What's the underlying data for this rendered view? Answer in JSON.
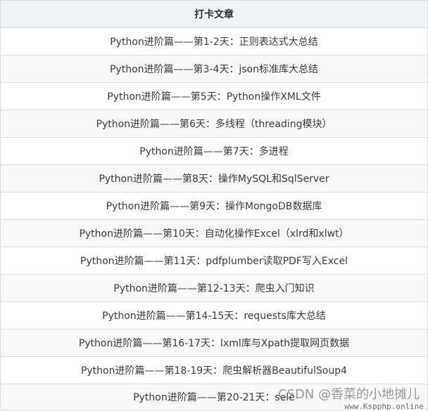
{
  "table": {
    "header": "打卡文章",
    "rows": [
      "Python进阶篇——第1-2天：正则表达式大总结",
      "Python进阶篇——第3-4天：json标准库大总结",
      "Python进阶篇——第5天：Python操作XML文件",
      "Python进阶篇——第6天：多线程（threading模块）",
      "Python进阶篇——第7天：多进程",
      "Python进阶篇——第8天：操作MySQL和SqlServer",
      "Python进阶篇——第9天：操作MongoDB数据库",
      "Python进阶篇——第10天：自动化操作Excel（xlrd和xlwt）",
      "Python进阶篇——第11天：pdfplumber读取PDF写入Excel",
      "Python进阶篇——第12-13天：爬虫入门知识",
      "Python进阶篇——第14-15天：requests库大总结",
      "Python进阶篇——第16-17天：lxml库与Xpath提取网页数据",
      "Python进阶篇——第18-19天：爬虫解析器BeautifulSoup4",
      "Python进阶篇——第20-21天：sele"
    ]
  },
  "watermark": {
    "text": "CSDN @香菜的小地摊儿",
    "site": "www.Kspphp.online"
  }
}
